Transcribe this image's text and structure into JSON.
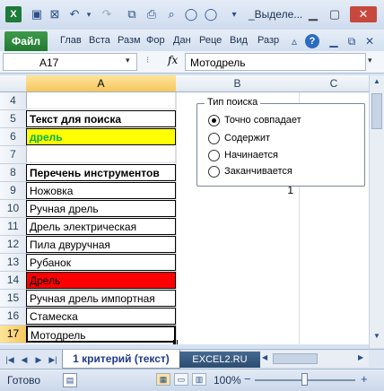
{
  "window": {
    "title": "_Выделе...",
    "qa_icons": [
      "excel-logo-icon",
      "save-icon",
      "close-file-icon",
      "undo-icon",
      "redo-icon",
      "save-all-icon",
      "print-icon",
      "zoom-icon",
      "circle-icon",
      "circle-icon",
      "dropdown-icon"
    ]
  },
  "ribbon": {
    "file_tab": "Файл",
    "tabs": [
      "Глав",
      "Вста",
      "Разм",
      "Фор",
      "Дан",
      "Реце",
      "Вид",
      "Разр"
    ],
    "help_icon": "?"
  },
  "formula_bar": {
    "name_box": "A17",
    "fx": "fx",
    "formula": "Мотодрель"
  },
  "grid": {
    "columns": [
      "A",
      "B",
      "C"
    ],
    "rows": [
      {
        "num": "4",
        "a": "",
        "b": ""
      },
      {
        "num": "5",
        "a": "Текст для поиска",
        "b": ""
      },
      {
        "num": "6",
        "a": "дрель",
        "b": ""
      },
      {
        "num": "7",
        "a": "",
        "b": ""
      },
      {
        "num": "8",
        "a": "Перечень инструментов",
        "b": ""
      },
      {
        "num": "9",
        "a": "Ножовка",
        "b": "1"
      },
      {
        "num": "10",
        "a": "Ручная дрель",
        "b": ""
      },
      {
        "num": "11",
        "a": "Дрель электрическая",
        "b": ""
      },
      {
        "num": "12",
        "a": "Пила двуручная",
        "b": ""
      },
      {
        "num": "13",
        "a": "Рубанок",
        "b": ""
      },
      {
        "num": "14",
        "a": "Дрель",
        "b": ""
      },
      {
        "num": "15",
        "a": "Ручная дрель импортная",
        "b": ""
      },
      {
        "num": "16",
        "a": "Стамеска",
        "b": ""
      },
      {
        "num": "17",
        "a": "Мотодрель",
        "b": ""
      }
    ],
    "colors": {
      "yellow": "#ffff00",
      "red": "#ff0000",
      "green_text": "#00b050"
    }
  },
  "search_group": {
    "title": "Тип поиска",
    "options": [
      "Точно совпадает",
      "Содержит",
      "Начинается",
      "Заканчивается"
    ],
    "selected": 0
  },
  "sheet_tabs": {
    "active": "1 критерий (текст)",
    "ad": "EXCEL2.RU"
  },
  "status": {
    "ready": "Готово",
    "zoom": "100%",
    "zoom_minus": "−",
    "zoom_plus": "+"
  }
}
